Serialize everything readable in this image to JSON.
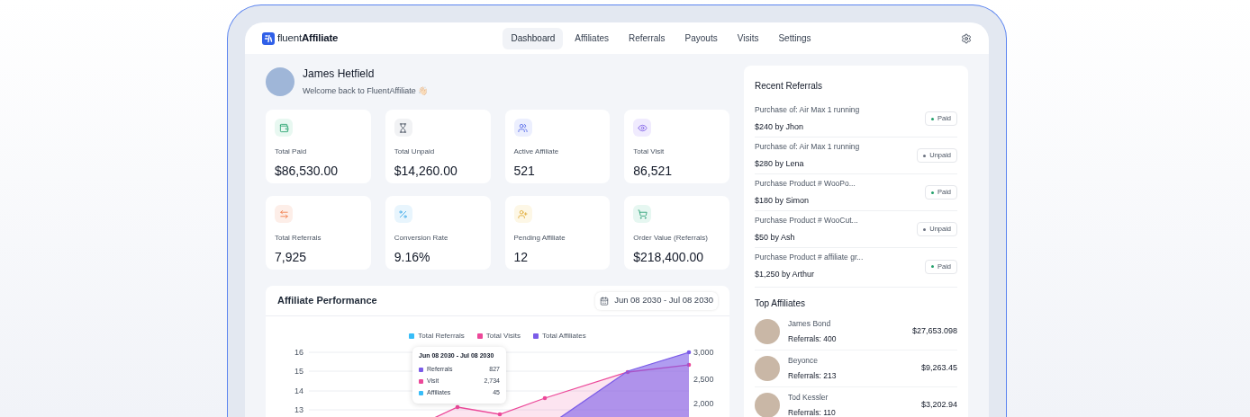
{
  "brand": {
    "prefix": "fluent",
    "name": "Affiliate"
  },
  "nav": [
    {
      "label": "Dashboard",
      "selected": true
    },
    {
      "label": "Affiliates",
      "selected": false
    },
    {
      "label": "Referrals",
      "selected": false
    },
    {
      "label": "Payouts",
      "selected": false
    },
    {
      "label": "Visits",
      "selected": false
    },
    {
      "label": "Settings",
      "selected": false
    }
  ],
  "user": {
    "name": "James Hetfield",
    "greeting": "Welcome back to FluentAffiliate 👋🏻"
  },
  "stats": [
    {
      "label": "Total Paid",
      "value": "$86,530.00"
    },
    {
      "label": "Total Unpaid",
      "value": "$14,260.00"
    },
    {
      "label": "Active Affiliate",
      "value": "521"
    },
    {
      "label": "Total Visit",
      "value": "86,521"
    },
    {
      "label": "Total Referrals",
      "value": "7,925"
    },
    {
      "label": "Conversion Rate",
      "value": "9.16%"
    },
    {
      "label": "Pending Affiliate",
      "value": "12"
    },
    {
      "label": "Order Value (Referrals)",
      "value": "$218,400.00"
    }
  ],
  "performance": {
    "title": "Affiliate Performance",
    "date_range": "Jun 08 2030 - Jul 08 2030",
    "legend": [
      {
        "label": "Total Referrals",
        "color": "#38bdf8"
      },
      {
        "label": "Total Visits",
        "color": "#ec4899"
      },
      {
        "label": "Total Affiliates",
        "color": "#7b5ce8"
      }
    ],
    "left_ticks": [
      "16",
      "15",
      "14",
      "13"
    ],
    "right_ticks": [
      "3,000",
      "2,500",
      "2,000"
    ],
    "tooltip": {
      "title": "Jun 08 2030 - Jul 08 2030",
      "rows": [
        {
          "label": "Referrals",
          "value": "827",
          "color": "#7b5ce8"
        },
        {
          "label": "Visit",
          "value": "2,734",
          "color": "#ec4899"
        },
        {
          "label": "Affiliates",
          "value": "45",
          "color": "#38bdf8"
        }
      ]
    }
  },
  "recent_referrals": {
    "title": "Recent Referrals",
    "items": [
      {
        "product": "Purchase of: Air Max 1 running",
        "amount": "$240 by Jhon",
        "status": "Paid",
        "paid": true
      },
      {
        "product": "Purchase of: Air Max 1 running",
        "amount": "$280 by Lena",
        "status": "Unpaid",
        "paid": false
      },
      {
        "product": "Purchase Product # WooPo...",
        "amount": "$180 by Simon",
        "status": "Paid",
        "paid": true
      },
      {
        "product": "Purchase Product # WooCut...",
        "amount": "$50 by Ash",
        "status": "Unpaid",
        "paid": false
      },
      {
        "product": "Purchase Product # affiliate gr...",
        "amount": "$1,250 by Arthur",
        "status": "Paid",
        "paid": true
      }
    ]
  },
  "top_affiliates": {
    "title": "Top Affiliates",
    "items": [
      {
        "name": "James Bond",
        "referrals": "Referrals: 400",
        "earnings": "$27,653.098"
      },
      {
        "name": "Beyonce",
        "referrals": "Referrals: 213",
        "earnings": "$9,263.45"
      },
      {
        "name": "Tod Kessler",
        "referrals": "Referrals: 110",
        "earnings": "$3,202.94"
      }
    ]
  }
}
